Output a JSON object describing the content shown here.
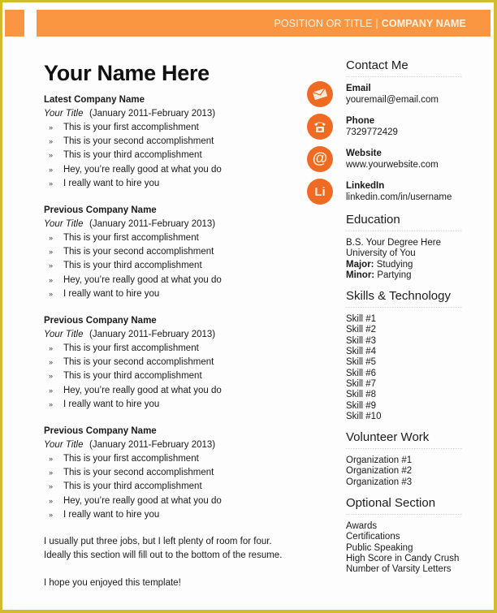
{
  "header": {
    "position": "POSITION OR TITLE",
    "separator": "|",
    "company": "COMPANY NAME",
    "accent_color": "#fa9642",
    "border_color": "#d4bb2c"
  },
  "name": "Your Name Here",
  "jobs": [
    {
      "company": "Latest Company Name",
      "title": "Your Title",
      "dates": "(January 2011-February 2013)",
      "bullets": [
        "This is your first accomplishment",
        "This is your second accomplishment",
        "This is  your third accomplishment",
        "Hey, you’re really good at what you do",
        "I really want to hire you"
      ]
    },
    {
      "company": "Previous Company Name",
      "title": "Your Title",
      "dates": "(January 2011-February 2013)",
      "bullets": [
        "This is your first accomplishment",
        "This is your second accomplishment",
        "This is  your third accomplishment",
        "Hey, you’re really good at what you do",
        "I really want to hire you"
      ]
    },
    {
      "company": "Previous Company Name",
      "title": "Your Title",
      "dates": "(January 2011-February 2013)",
      "bullets": [
        "This is your first accomplishment",
        "This is your second accomplishment",
        "This is  your third accomplishment",
        "Hey, you’re really good at what you do",
        "I really want to hire you"
      ]
    },
    {
      "company": "Previous Company Name",
      "title": "Your Title",
      "dates": "(January 2011-February 2013)",
      "bullets": [
        "This is your first accomplishment",
        "This is your second accomplishment",
        "This is  your third accomplishment",
        "Hey, you’re really good at what you do",
        "I really want to hire you"
      ]
    }
  ],
  "bullet_mark": "»",
  "closing": [
    "I usually put three jobs, but I left plenty of room for four. Ideally this section will fill out to the bottom of the resume.",
    "I hope you enjoyed this template!"
  ],
  "contact": {
    "title": "Contact Me",
    "icon_color": "#ef6a23",
    "items": [
      {
        "icon": "envelope-icon",
        "label": "Email",
        "value": "youremail@email.com"
      },
      {
        "icon": "telephone-icon",
        "label": "Phone",
        "value": "7329772429"
      },
      {
        "icon": "at-sign-icon",
        "glyph": "@",
        "label": "Website",
        "value": "www.yourwebsite.com"
      },
      {
        "icon": "linkedin-icon",
        "glyph": "Li",
        "label": "LinkedIn",
        "value": "linkedin.com/in/username"
      }
    ]
  },
  "education": {
    "title": "Education",
    "degree": "B.S. Your Degree Here",
    "school": "University of You",
    "major_label": "Major:",
    "major": "Studying",
    "minor_label": "Minor:",
    "minor": "Partying"
  },
  "skills": {
    "title": "Skills & Technology",
    "items": [
      "Skill #1",
      "Skill #2",
      "Skill #3",
      "Skill #4",
      "Skill #5",
      "Skill #6",
      "Skill #7",
      "Skill #8",
      "Skill #9",
      "Skill #10"
    ]
  },
  "volunteer": {
    "title": "Volunteer Work",
    "items": [
      "Organization #1",
      "Organization #2",
      "Organization #3"
    ]
  },
  "optional": {
    "title": "Optional Section",
    "items": [
      "Awards",
      "Certifications",
      "Public Speaking",
      "High Score in Candy Crush",
      "Number of Varsity Letters"
    ]
  }
}
